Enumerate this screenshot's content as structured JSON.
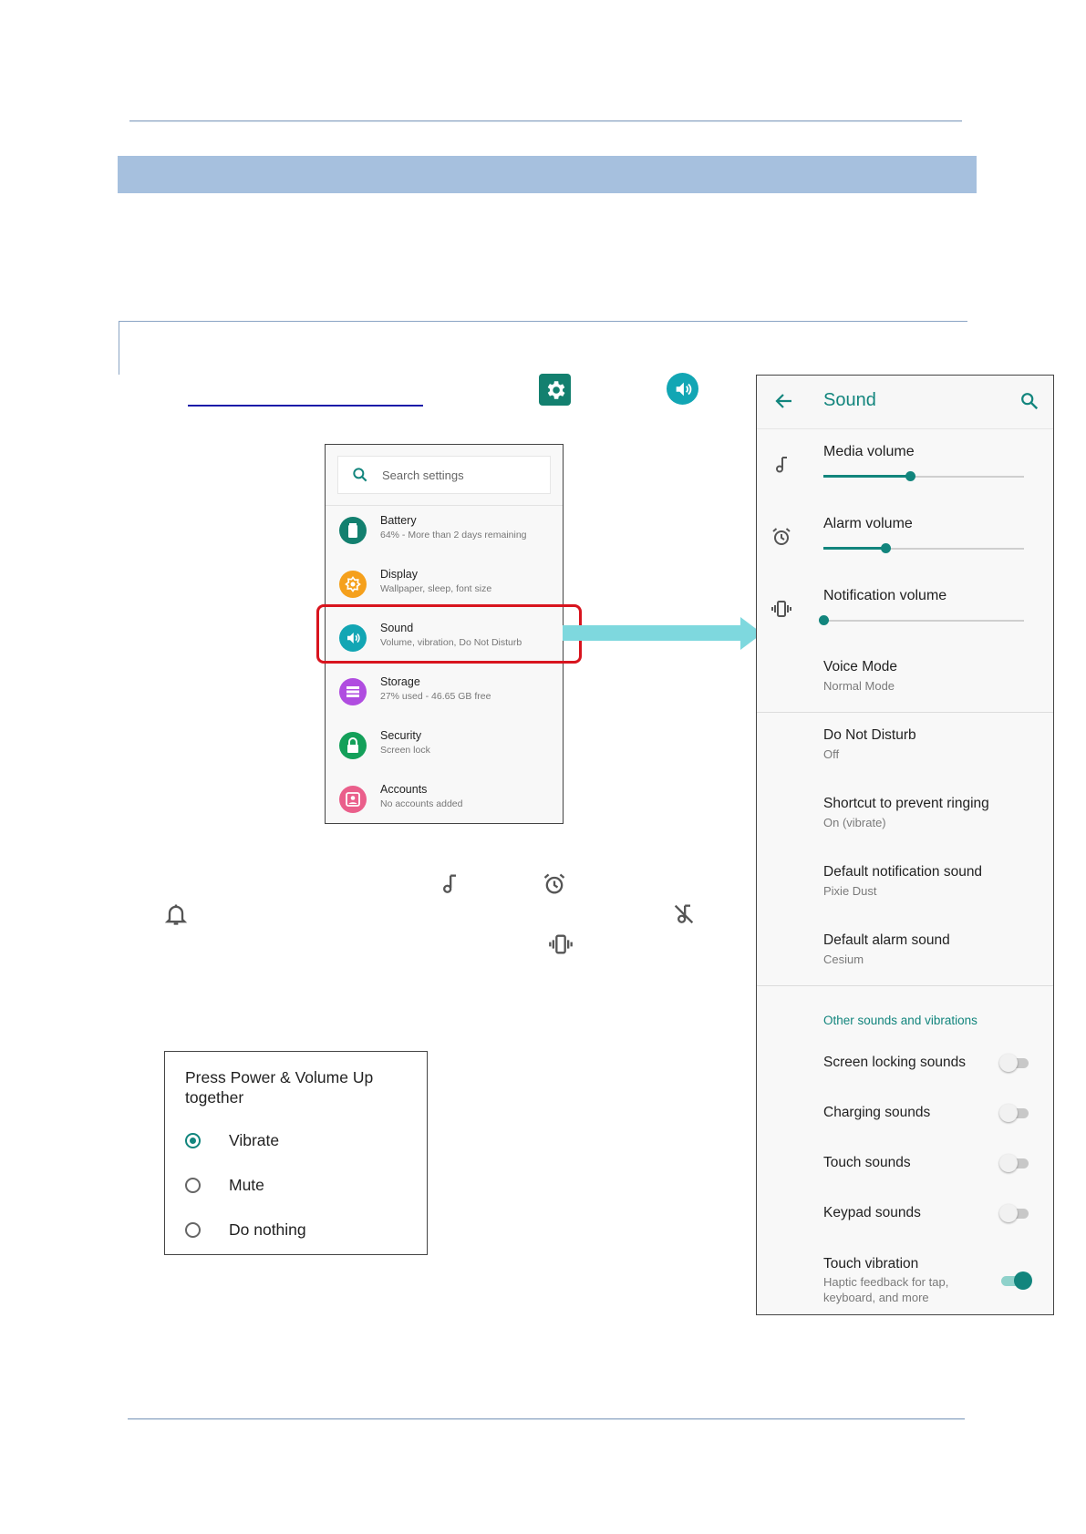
{
  "settings_list": {
    "search_placeholder": "Search settings",
    "items": [
      {
        "title": "Battery",
        "subtitle": "64% - More than 2 days remaining",
        "icon": "battery-icon",
        "color": "#13806f"
      },
      {
        "title": "Display",
        "subtitle": "Wallpaper, sleep, font size",
        "icon": "brightness-icon",
        "color": "#f5a01c"
      },
      {
        "title": "Sound",
        "subtitle": "Volume, vibration, Do Not Disturb",
        "icon": "volume-icon",
        "color": "#12a6b4"
      },
      {
        "title": "Storage",
        "subtitle": "27% used - 46.65 GB free",
        "icon": "storage-icon",
        "color": "#b04de0"
      },
      {
        "title": "Security",
        "subtitle": "Screen lock",
        "icon": "lock-icon",
        "color": "#14a05a"
      },
      {
        "title": "Accounts",
        "subtitle": "No accounts added",
        "icon": "account-icon",
        "color": "#ea5f8b"
      }
    ]
  },
  "sound_screen": {
    "title": "Sound",
    "volumes": [
      {
        "label": "Media volume",
        "icon": "music-note-icon",
        "level": 0.43
      },
      {
        "label": "Alarm volume",
        "icon": "alarm-clock-icon",
        "level": 0.31
      },
      {
        "label": "Notification volume",
        "icon": "vibrate-icon",
        "level": 0.0
      }
    ],
    "voice_mode": {
      "label": "Voice Mode",
      "value": "Normal Mode"
    },
    "dnd": {
      "label": "Do Not Disturb",
      "value": "Off"
    },
    "shortcut": {
      "label": "Shortcut to prevent ringing",
      "value": "On (vibrate)"
    },
    "notification_sound": {
      "label": "Default notification sound",
      "value": "Pixie Dust"
    },
    "alarm_sound": {
      "label": "Default alarm sound",
      "value": "Cesium"
    },
    "section_header": "Other sounds and vibrations",
    "toggles": [
      {
        "label": "Screen locking sounds",
        "on": false
      },
      {
        "label": "Charging sounds",
        "on": false
      },
      {
        "label": "Touch sounds",
        "on": false
      },
      {
        "label": "Keypad sounds",
        "on": false
      }
    ],
    "touch_vibration": {
      "label": "Touch vibration",
      "desc_line1": "Haptic feedback for tap,",
      "desc_line2": "keyboard, and more",
      "on": true
    },
    "accent_color": "#12857d"
  },
  "dialog": {
    "title_line1": "Press Power & Volume Up",
    "title_line2": "together",
    "options": [
      {
        "label": "Vibrate",
        "selected": true
      },
      {
        "label": "Mute",
        "selected": false
      },
      {
        "label": "Do nothing",
        "selected": false
      }
    ]
  },
  "colors": {
    "header_band": "#a6c0de",
    "highlight": "#d8141e",
    "arrow": "#7ed8de",
    "settings_tile": "#13806f",
    "sound_tile": "#12a6b4"
  }
}
